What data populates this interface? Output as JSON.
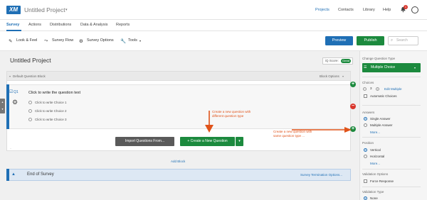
{
  "header": {
    "logo": "XM",
    "project_title": "Untitled Project",
    "nav": [
      "Projects",
      "Contacts",
      "Library",
      "Help"
    ],
    "notification_count": "1"
  },
  "tabs": [
    "Survey",
    "Actions",
    "Distributions",
    "Data & Analysis",
    "Reports"
  ],
  "toolbar": {
    "tools": [
      "Look & Feel",
      "Survey Flow",
      "Survey Options",
      "Tools"
    ],
    "preview": "Preview",
    "publish": "Publish",
    "search_placeholder": "Search"
  },
  "survey": {
    "title": "Untitled Project",
    "iq_score_label": "iQ Score:",
    "iq_score_value": "Great",
    "block_name": "Default Question Block",
    "block_options": "Block Options",
    "question_id": "Q1",
    "question_text": "Click to write the question text",
    "choices": [
      "Click to write Choice 1",
      "Click to write Choice 2",
      "Click to write Choice 3"
    ],
    "import_button": "Import Questions From...",
    "create_button": "Create a New Question",
    "add_block": "Add Block",
    "end_of_survey": "End of Survey",
    "termination_options": "Survey Termination Options..."
  },
  "annotations": {
    "different_type": [
      "Create a new question with",
      "different question type"
    ],
    "same_type": [
      "Create a new question with",
      "same question type ..."
    ]
  },
  "panel": {
    "change_type_label": "Change Question Type",
    "question_type": "Multiple Choice",
    "choices_label": "Choices",
    "choices_count": "3",
    "edit_multiple": "Edit Multiple",
    "automatic_choices": "Automatic Choices",
    "answers_label": "Answers",
    "answers": [
      "Single Answer",
      "Multiple Answer"
    ],
    "answers_more": "More...",
    "position_label": "Position",
    "positions": [
      "Vertical",
      "Horizontal"
    ],
    "position_more": "More...",
    "validation_options_label": "Validation Options",
    "force_response": "Force Response",
    "validation_type_label": "Validation Type",
    "validation_none": "None"
  },
  "colors": {
    "brand_blue": "#1f6fb5",
    "green": "#1c8a3e",
    "red": "#d9362c",
    "annotation_orange": "#e0531a"
  }
}
